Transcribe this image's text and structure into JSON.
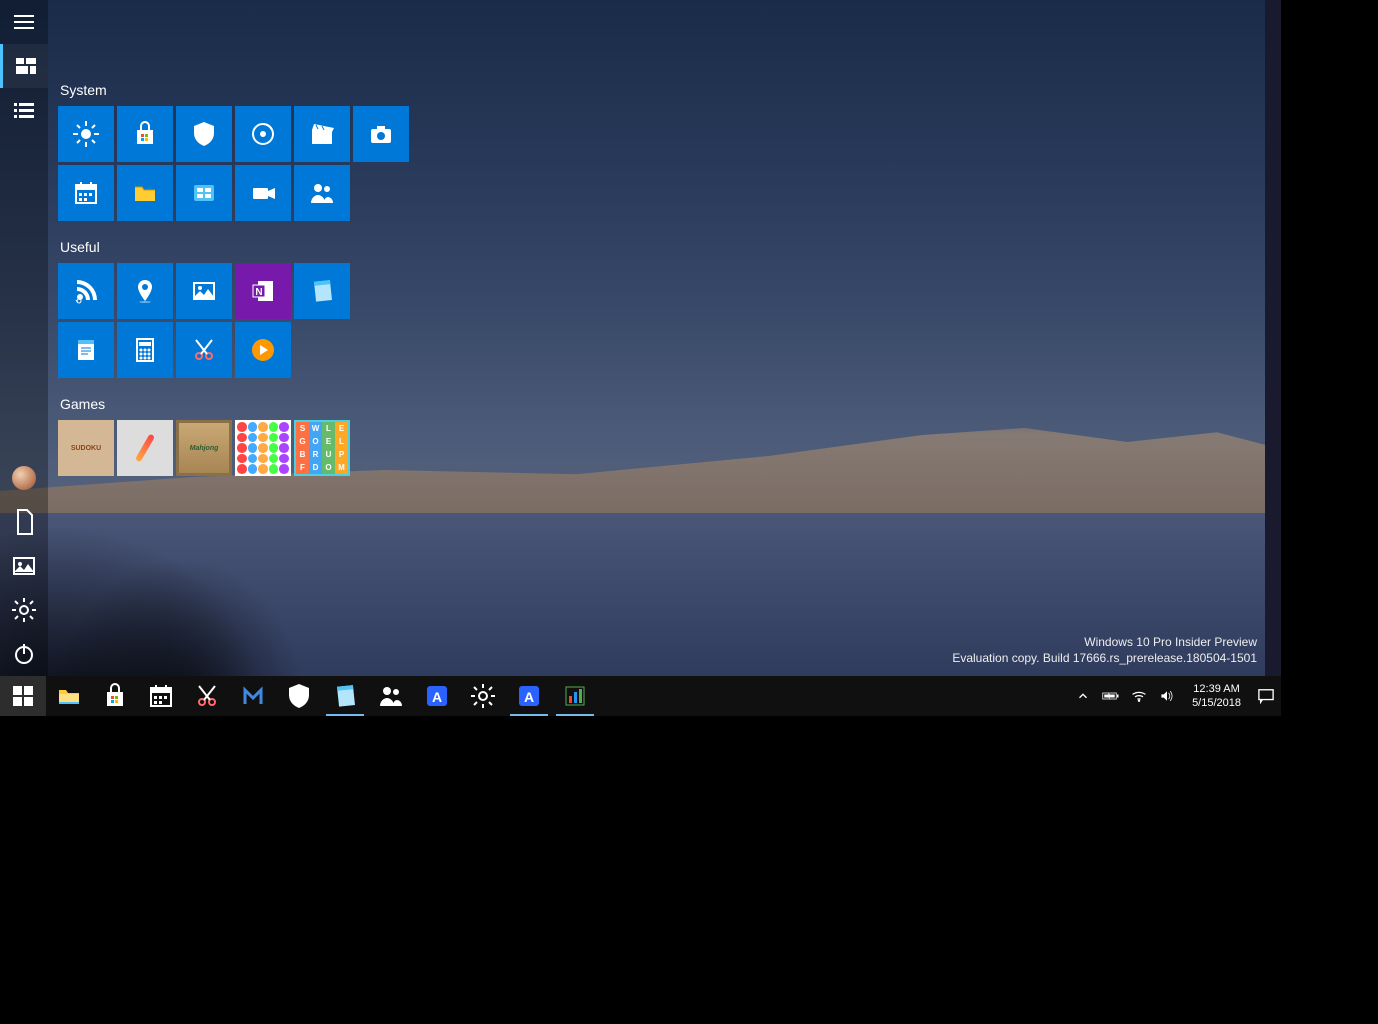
{
  "watermark": {
    "line1": "Windows 10 Pro Insider Preview",
    "line2": "Evaluation copy. Build 17666.rs_prerelease.180504-1501"
  },
  "start": {
    "rail": [
      {
        "name": "hamburger",
        "icon": "menu"
      },
      {
        "name": "pinned",
        "icon": "grid",
        "active": true
      },
      {
        "name": "all-apps",
        "icon": "list"
      }
    ],
    "rail_bottom": [
      {
        "name": "user",
        "icon": "avatar"
      },
      {
        "name": "documents",
        "icon": "document"
      },
      {
        "name": "pictures",
        "icon": "pictures"
      },
      {
        "name": "settings",
        "icon": "gear"
      },
      {
        "name": "power",
        "icon": "power"
      }
    ],
    "groups": [
      {
        "title": "System",
        "rows": [
          [
            {
              "name": "settings",
              "color": "blue",
              "icon": "sun"
            },
            {
              "name": "store",
              "color": "blue",
              "icon": "store"
            },
            {
              "name": "security",
              "color": "blue",
              "icon": "shield"
            },
            {
              "name": "disc",
              "color": "blue",
              "icon": "disc"
            },
            {
              "name": "movies",
              "color": "blue",
              "icon": "clapboard"
            },
            {
              "name": "camera",
              "color": "blue",
              "icon": "camera"
            }
          ],
          [
            {
              "name": "calendar",
              "color": "blue",
              "icon": "calendar"
            },
            {
              "name": "files",
              "color": "blue",
              "icon": "folder"
            },
            {
              "name": "control-panel",
              "color": "blue",
              "icon": "panel"
            },
            {
              "name": "video",
              "color": "blue",
              "icon": "video"
            },
            {
              "name": "people",
              "color": "blue",
              "icon": "people"
            }
          ]
        ]
      },
      {
        "title": "Useful",
        "rows": [
          [
            {
              "name": "rss",
              "color": "blue",
              "icon": "rss"
            },
            {
              "name": "maps",
              "color": "blue",
              "icon": "pin"
            },
            {
              "name": "photos",
              "color": "blue",
              "icon": "photo"
            },
            {
              "name": "onenote",
              "color": "purple",
              "icon": "onenote"
            },
            {
              "name": "notepad",
              "color": "blue",
              "icon": "notepad"
            }
          ],
          [
            {
              "name": "wordpad",
              "color": "blue",
              "icon": "wordpad"
            },
            {
              "name": "calculator",
              "color": "blue",
              "icon": "calc"
            },
            {
              "name": "snip",
              "color": "blue",
              "icon": "snip"
            },
            {
              "name": "media-player",
              "color": "blue",
              "icon": "play"
            }
          ]
        ]
      },
      {
        "title": "Games",
        "rows": [
          [
            {
              "name": "sudoku",
              "color": "img",
              "icon": "game1",
              "label": "SUDOKU"
            },
            {
              "name": "pencil-game",
              "color": "img",
              "icon": "game2"
            },
            {
              "name": "mahjong",
              "color": "img",
              "icon": "game3",
              "label": "Mahjong"
            },
            {
              "name": "dots-game",
              "color": "img",
              "icon": "game4"
            },
            {
              "name": "word-game",
              "color": "img",
              "icon": "game5"
            }
          ]
        ]
      }
    ]
  },
  "taskbar": {
    "items": [
      {
        "name": "start",
        "icon": "win",
        "active": true
      },
      {
        "name": "file-explorer",
        "icon": "explorer"
      },
      {
        "name": "store",
        "icon": "store"
      },
      {
        "name": "calendar",
        "icon": "calendar"
      },
      {
        "name": "snip",
        "icon": "snip"
      },
      {
        "name": "malwarebytes",
        "icon": "m"
      },
      {
        "name": "defender",
        "icon": "shield"
      },
      {
        "name": "notepad",
        "icon": "notepad",
        "running": true
      },
      {
        "name": "people",
        "icon": "people"
      },
      {
        "name": "app-a",
        "icon": "A"
      },
      {
        "name": "settings",
        "icon": "gear"
      },
      {
        "name": "app-a2",
        "icon": "A",
        "running": true
      },
      {
        "name": "app-chart",
        "icon": "chart",
        "running": true
      }
    ],
    "systray": {
      "icons": [
        "chevron-up",
        "battery",
        "wifi",
        "volume"
      ],
      "time": "12:39 AM",
      "date": "5/15/2018"
    }
  }
}
